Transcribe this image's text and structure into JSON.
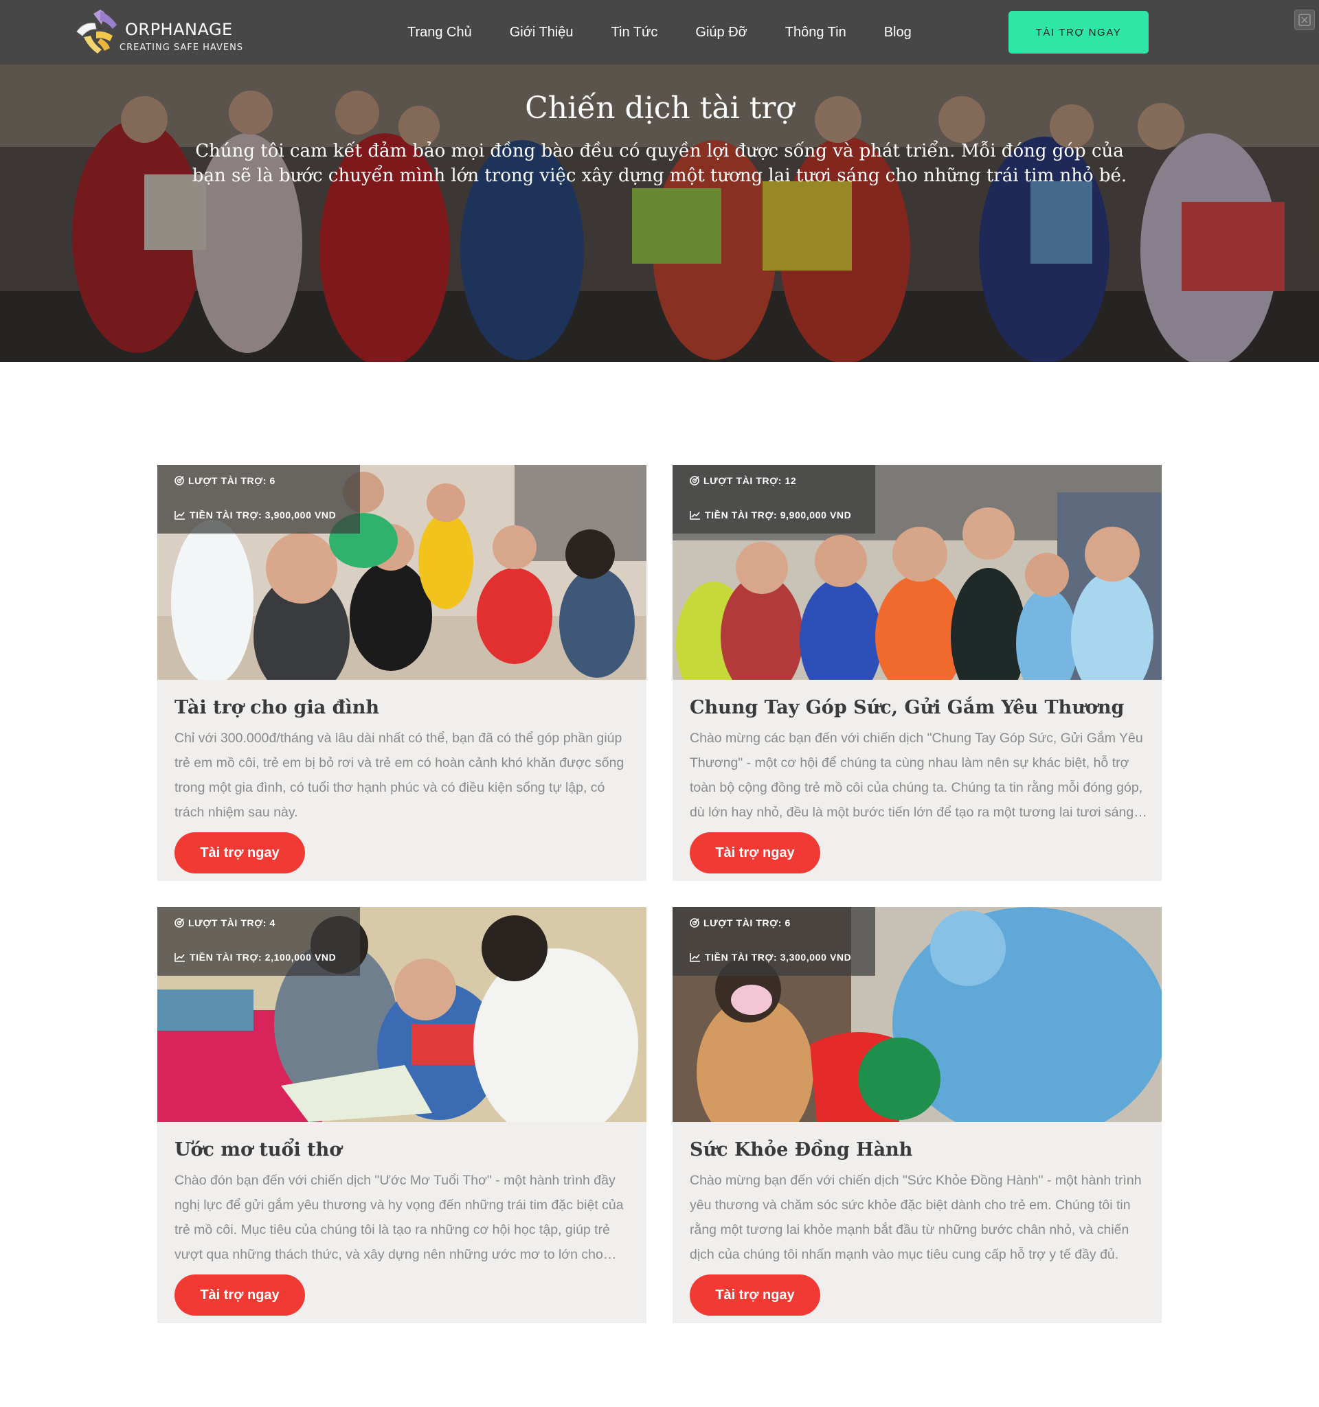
{
  "header": {
    "logo_title": "ORPHANAGE",
    "logo_tagline": "CREATING SAFE HAVENS",
    "nav": [
      "Trang Chủ",
      "Giới Thiệu",
      "Tin Tức",
      "Giúp Đỡ",
      "Thông Tin",
      "Blog"
    ],
    "cta_label": "TÀI TRỢ NGAY"
  },
  "hero": {
    "title": "Chiến dịch tài trợ",
    "text": "Chúng tôi cam kết đảm bảo mọi đồng bào đều có quyền lợi được sống và phát triển. Mỗi đóng góp của bạn sẽ là bước chuyển mình lớn trong việc xây dựng một tương lai tươi sáng cho những trái tim nhỏ bé."
  },
  "campaigns": [
    {
      "donations": "LƯỢT TÀI TRỢ: 6",
      "amount": "TIỀN TÀI TRỢ: 3,900,000 VND",
      "title": "Tài trợ cho gia đình",
      "description": "Chỉ với 300.000đ/tháng và lâu dài nhất có thể, bạn đã có thể góp phần giúp trẻ em mồ côi, trẻ em bị bỏ rơi và trẻ em có hoàn cảnh khó khăn được sống trong một gia đình, có tuổi thơ hạnh phúc và có điều kiện sống tự lập, có trách nhiệm sau này.",
      "button": "Tài trợ ngay"
    },
    {
      "donations": "LƯỢT TÀI TRỢ: 12",
      "amount": "TIỀN TÀI TRỢ: 9,900,000 VND",
      "title": "Chung Tay Góp Sức, Gửi Gắm Yêu Thương",
      "description": "Chào mừng các bạn đến với chiến dịch \"Chung Tay Góp Sức, Gửi Gắm Yêu Thương\" - một cơ hội để chúng ta cùng nhau làm nên sự khác biệt, hỗ trợ toàn bộ cộng đồng trẻ mồ côi của chúng ta. Chúng ta tin rằng mỗi đóng góp, dù lớn hay nhỏ, đều là một bước tiến lớn để tạo ra một tương lai tươi sáng hơn.",
      "button": "Tài trợ ngay"
    },
    {
      "donations": "LƯỢT TÀI TRỢ: 4",
      "amount": "TIỀN TÀI TRỢ: 2,100,000 VND",
      "title": "Ước mơ tuổi thơ",
      "description": "Chào đón bạn đến với chiến dịch \"Ước Mơ Tuổi Thơ\" - một hành trình đầy nghị lực để gửi gắm yêu thương và hy vọng đến những trái tim đặc biệt của trẻ mồ côi. Mục tiêu của chúng tôi là tạo ra những cơ hội học tập, giúp trẻ vượt qua những thách thức, và xây dựng nên những ước mơ to lớn cho tương lai.",
      "button": "Tài trợ ngay"
    },
    {
      "donations": "LƯỢT TÀI TRỢ: 6",
      "amount": "TIỀN TÀI TRỢ: 3,300,000 VND",
      "title": "Sức Khỏe Đồng Hành",
      "description": "Chào mừng bạn đến với chiến dịch \"Sức Khỏe Đồng Hành\" - một hành trình yêu thương và chăm sóc sức khỏe đặc biệt dành cho trẻ em. Chúng tôi tin rằng một tương lai khỏe mạnh bắt đầu từ những bước chân nhỏ, và chiến dịch của chúng tôi nhấn mạnh vào mục tiêu cung cấp hỗ trợ y tế đầy đủ.",
      "button": "Tài trợ ngay"
    }
  ],
  "colors": {
    "header_bg": "#474747",
    "cta_bg": "#2ee6a6",
    "button_red": "#f23a35",
    "card_bg": "#f0efed"
  }
}
